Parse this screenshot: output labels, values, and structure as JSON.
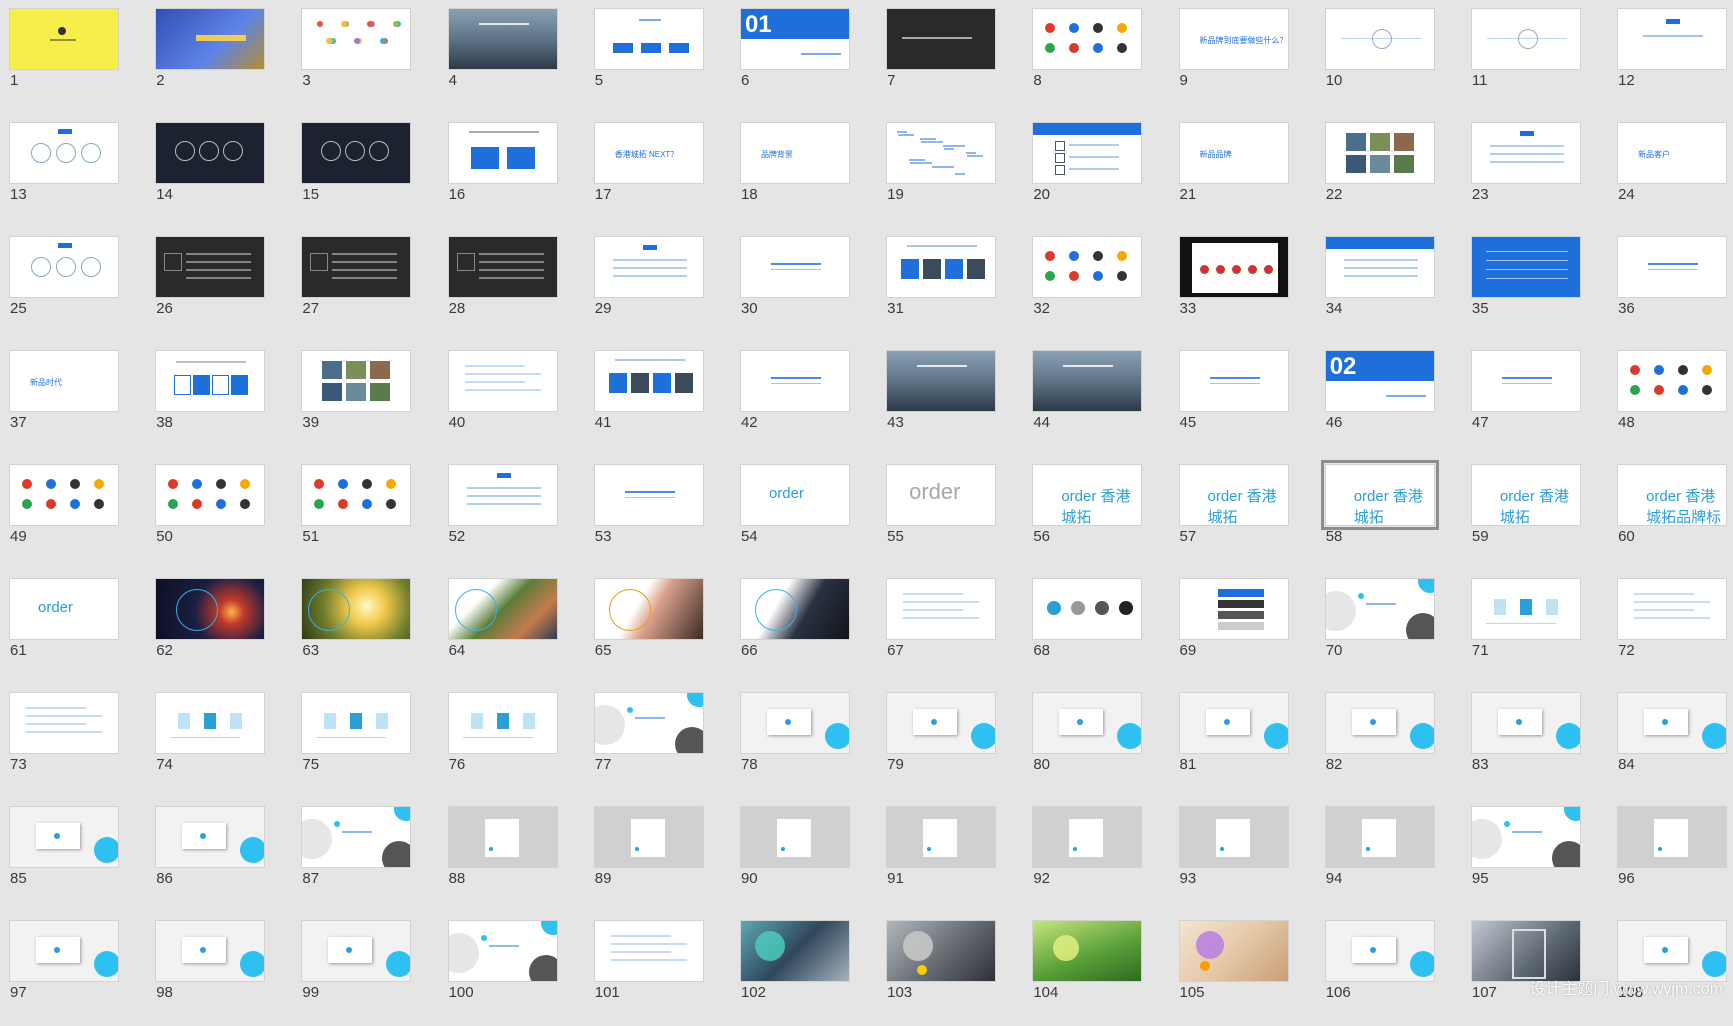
{
  "window": {
    "view": "slide-sorter",
    "selected_slide": 58,
    "watermark": "设计主题门 www.wyjm.com"
  },
  "accent_color": "#1e6fd9",
  "thumb_text": {
    "s6": "01",
    "s46": "02",
    "s9": "新品牌到底要做些什么？",
    "s17": "香港城拓 NEXT？",
    "s18": "品牌背景",
    "s21": "新品品牌",
    "s24": "新品客户",
    "s37": "新品时代",
    "s54": "order",
    "s55": "order",
    "s56": "order 香港城拓",
    "s57": "order 香港城拓",
    "s58": "order 香港城拓",
    "s59": "order 香港城拓",
    "s60": "order 香港城拓品牌标识",
    "s61": "order"
  },
  "slides": [
    {
      "n": 1,
      "v": "yellow"
    },
    {
      "n": 2,
      "v": "factory"
    },
    {
      "n": 3,
      "v": "dots"
    },
    {
      "n": 4,
      "v": "photo"
    },
    {
      "n": 5,
      "v": "toc"
    },
    {
      "n": 6,
      "v": "bignum"
    },
    {
      "n": 7,
      "v": "dark"
    },
    {
      "n": 8,
      "v": "logos"
    },
    {
      "n": 9,
      "v": "title"
    },
    {
      "n": 10,
      "v": "diagram"
    },
    {
      "n": 11,
      "v": "diagram"
    },
    {
      "n": 12,
      "v": "tag"
    },
    {
      "n": 13,
      "v": "circles"
    },
    {
      "n": 14,
      "v": "darkcircles"
    },
    {
      "n": 15,
      "v": "darkcircles"
    },
    {
      "n": 16,
      "v": "twobox"
    },
    {
      "n": 17,
      "v": "title"
    },
    {
      "n": 18,
      "v": "title"
    },
    {
      "n": 19,
      "v": "cloud"
    },
    {
      "n": 20,
      "v": "headerlist"
    },
    {
      "n": 21,
      "v": "title"
    },
    {
      "n": 22,
      "v": "photogrid"
    },
    {
      "n": 23,
      "v": "tagtext"
    },
    {
      "n": 24,
      "v": "title"
    },
    {
      "n": 25,
      "v": "circles"
    },
    {
      "n": 26,
      "v": "darktext"
    },
    {
      "n": 27,
      "v": "darktext"
    },
    {
      "n": 28,
      "v": "darktext"
    },
    {
      "n": 29,
      "v": "tagtext"
    },
    {
      "n": 30,
      "v": "underline"
    },
    {
      "n": 31,
      "v": "photostrip"
    },
    {
      "n": 32,
      "v": "logos"
    },
    {
      "n": 33,
      "v": "blacklogos"
    },
    {
      "n": 34,
      "v": "headertext"
    },
    {
      "n": 35,
      "v": "bluefill"
    },
    {
      "n": 36,
      "v": "underline"
    },
    {
      "n": 37,
      "v": "title"
    },
    {
      "n": 38,
      "v": "fourbox"
    },
    {
      "n": 39,
      "v": "photogrid"
    },
    {
      "n": 40,
      "v": "text"
    },
    {
      "n": 41,
      "v": "photostrip"
    },
    {
      "n": 42,
      "v": "underline"
    },
    {
      "n": 43,
      "v": "photo"
    },
    {
      "n": 44,
      "v": "photo"
    },
    {
      "n": 45,
      "v": "underline"
    },
    {
      "n": 46,
      "v": "bignum"
    },
    {
      "n": 47,
      "v": "underline"
    },
    {
      "n": 48,
      "v": "logos"
    },
    {
      "n": 49,
      "v": "logos"
    },
    {
      "n": 50,
      "v": "logos"
    },
    {
      "n": 51,
      "v": "logos"
    },
    {
      "n": 52,
      "v": "tagtext"
    },
    {
      "n": 53,
      "v": "underline"
    },
    {
      "n": 54,
      "v": "order"
    },
    {
      "n": 55,
      "v": "ordergray"
    },
    {
      "n": 56,
      "v": "order"
    },
    {
      "n": 57,
      "v": "order"
    },
    {
      "n": 58,
      "v": "order"
    },
    {
      "n": 59,
      "v": "order"
    },
    {
      "n": 60,
      "v": "order"
    },
    {
      "n": 61,
      "v": "order"
    },
    {
      "n": 62,
      "v": "space"
    },
    {
      "n": 63,
      "v": "sun"
    },
    {
      "n": 64,
      "v": "people"
    },
    {
      "n": 65,
      "v": "hands"
    },
    {
      "n": 66,
      "v": "light"
    },
    {
      "n": 67,
      "v": "text"
    },
    {
      "n": 68,
      "v": "dotsrow"
    },
    {
      "n": 69,
      "v": "swatches"
    },
    {
      "n": 70,
      "v": "bigdots"
    },
    {
      "n": 71,
      "v": "icons"
    },
    {
      "n": 72,
      "v": "text"
    },
    {
      "n": 73,
      "v": "text"
    },
    {
      "n": 74,
      "v": "icons"
    },
    {
      "n": 75,
      "v": "icons"
    },
    {
      "n": 76,
      "v": "icons"
    },
    {
      "n": 77,
      "v": "bigdots"
    },
    {
      "n": 78,
      "v": "mock"
    },
    {
      "n": 79,
      "v": "mock"
    },
    {
      "n": 80,
      "v": "mock"
    },
    {
      "n": 81,
      "v": "mock"
    },
    {
      "n": 82,
      "v": "mock"
    },
    {
      "n": 83,
      "v": "mock"
    },
    {
      "n": 84,
      "v": "mock"
    },
    {
      "n": 85,
      "v": "mock"
    },
    {
      "n": 86,
      "v": "mock"
    },
    {
      "n": 87,
      "v": "bigdots"
    },
    {
      "n": 88,
      "v": "graymock"
    },
    {
      "n": 89,
      "v": "graymock"
    },
    {
      "n": 90,
      "v": "graymock"
    },
    {
      "n": 91,
      "v": "graymock"
    },
    {
      "n": 92,
      "v": "graymock"
    },
    {
      "n": 93,
      "v": "graymock"
    },
    {
      "n": 94,
      "v": "graymock"
    },
    {
      "n": 95,
      "v": "bigdots"
    },
    {
      "n": 96,
      "v": "graymock"
    },
    {
      "n": 97,
      "v": "mock"
    },
    {
      "n": 98,
      "v": "mock"
    },
    {
      "n": 99,
      "v": "mock"
    },
    {
      "n": 100,
      "v": "bigdots"
    },
    {
      "n": 101,
      "v": "text"
    },
    {
      "n": 102,
      "v": "machine"
    },
    {
      "n": 103,
      "v": "road"
    },
    {
      "n": 104,
      "v": "grass"
    },
    {
      "n": 105,
      "v": "warm"
    },
    {
      "n": 106,
      "v": "mock"
    },
    {
      "n": 107,
      "v": "store"
    },
    {
      "n": 108,
      "v": "mock"
    }
  ]
}
